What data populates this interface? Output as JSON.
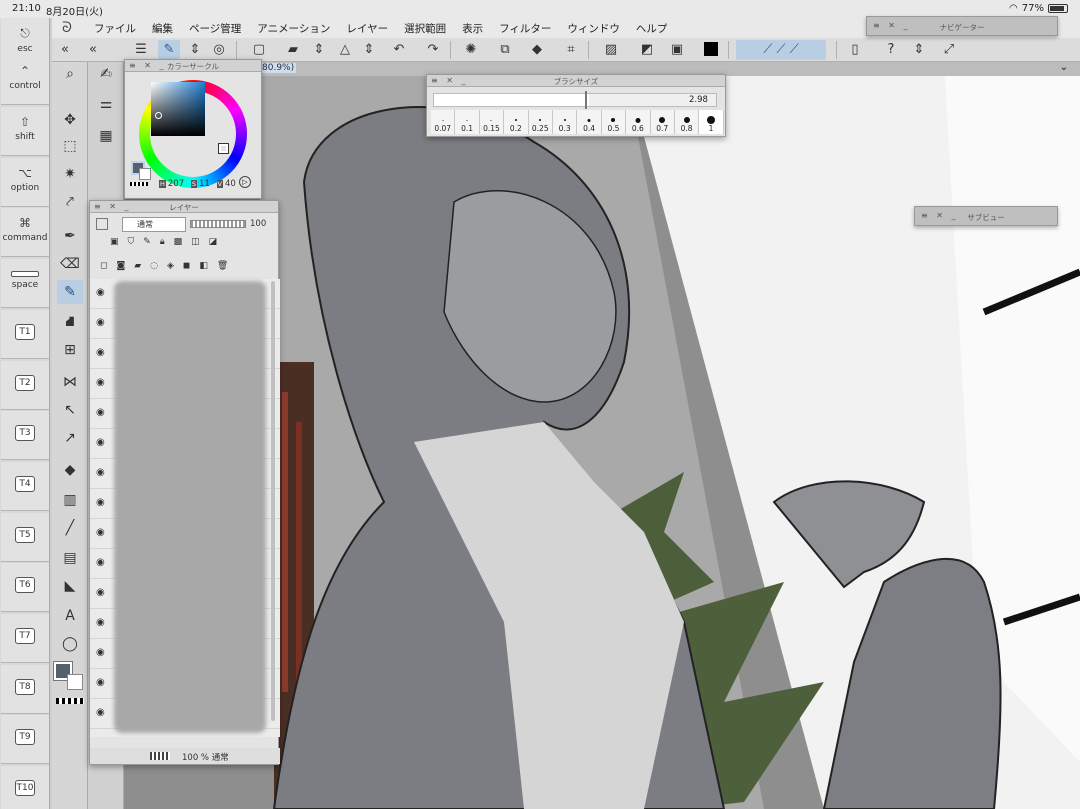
{
  "status": {
    "time": "21:10",
    "date": "8月20日(火)",
    "battery": "77%",
    "battery_level": 0.77
  },
  "menu": [
    "ファイル",
    "編集",
    "ページ管理",
    "アニメーション",
    "レイヤー",
    "選択範囲",
    "表示",
    "フィルター",
    "ウィンドウ",
    "ヘルプ"
  ],
  "keys": [
    {
      "sym": "⎋",
      "label": "esc"
    },
    {
      "sym": "⌃",
      "label": "control"
    },
    {
      "sym": "⇧",
      "label": "shift"
    },
    {
      "sym": "⌥",
      "label": "option"
    },
    {
      "sym": "⌘",
      "label": "command"
    },
    {
      "sym": "",
      "label": "space"
    },
    {
      "tbox": "T1"
    },
    {
      "tbox": "T2"
    },
    {
      "tbox": "T3"
    },
    {
      "tbox": "T4"
    },
    {
      "tbox": "T5"
    },
    {
      "tbox": "T6"
    },
    {
      "tbox": "T7"
    },
    {
      "tbox": "T8"
    },
    {
      "tbox": "T9"
    },
    {
      "tbox": "T10"
    }
  ],
  "canvas": {
    "zoom": "80.9%)"
  },
  "color_circle": {
    "title": "カラーサークル",
    "h_label": "H",
    "h": "207",
    "s_label": "S",
    "s": "11",
    "v_label": "V",
    "v": "40",
    "main_color": "#56606c"
  },
  "brush_size": {
    "title": "ブラシサイズ",
    "value": "2.98",
    "sizes": [
      "0.07",
      "0.1",
      "0.15",
      "0.2",
      "0.25",
      "0.3",
      "0.4",
      "0.5",
      "0.6",
      "0.7",
      "0.8",
      "1"
    ]
  },
  "layer": {
    "title": "レイヤー",
    "blend": "通常",
    "opacity": "100",
    "footer_opacity": "100 %",
    "footer_blend": "通常"
  },
  "navigator": {
    "title": "ナビゲーター"
  },
  "subview": {
    "title": "サブビュー"
  },
  "colors": {
    "accent": "#b9cde3",
    "panel": "#e4e4e4"
  }
}
